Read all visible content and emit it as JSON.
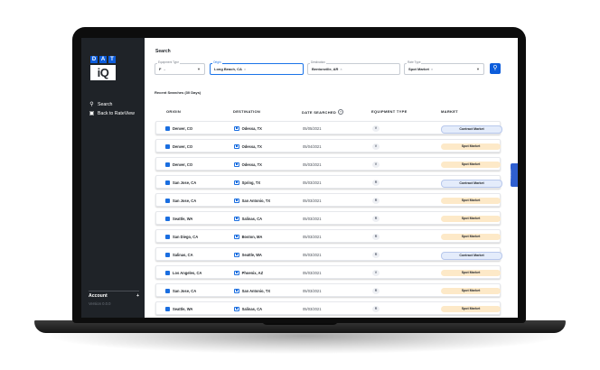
{
  "brand": {
    "dat_letters": [
      "D",
      "A",
      "T"
    ],
    "iq": "iQ"
  },
  "sidebar": {
    "items": [
      {
        "label": "Search",
        "icon": "search-icon"
      },
      {
        "label": "Back to RateView",
        "icon": "external-link-icon"
      }
    ],
    "account_label": "Account",
    "account_add": "+",
    "version": "Version 0.0.0"
  },
  "search": {
    "title": "Search",
    "equipment": {
      "label": "Equipment Type",
      "value": "F"
    },
    "origin": {
      "label": "Origin",
      "value": "Long Beach, CA"
    },
    "destination": {
      "label": "Destination",
      "value": "Bentonville, AR"
    },
    "rate_type": {
      "label": "Rate Type",
      "value": "Spot Market"
    },
    "button_icon": "search-icon"
  },
  "recent": {
    "title": "Recent Searches (30 Days)",
    "columns": {
      "origin": "ORIGIN",
      "destination": "DESTINATION",
      "date": "DATE SEARCHED",
      "date_help": "?",
      "equipment": "EQUIPMENT TYPE",
      "market": "MARKET"
    },
    "rows": [
      {
        "origin": "Denver, CO",
        "destination": "Odessa, TX",
        "date": "05/05/2021",
        "equipment": "V",
        "market": "Contract Market",
        "market_kind": "contract"
      },
      {
        "origin": "Denver, CO",
        "destination": "Odessa, TX",
        "date": "05/04/2021",
        "equipment": "V",
        "market": "Spot Market",
        "market_kind": "spot"
      },
      {
        "origin": "Denver, CO",
        "destination": "Odessa, TX",
        "date": "05/03/2021",
        "equipment": "V",
        "market": "Spot Market",
        "market_kind": "spot"
      },
      {
        "origin": "San Jose, CA",
        "destination": "Spring, TX",
        "date": "05/03/2021",
        "equipment": "R",
        "market": "Contract Market",
        "market_kind": "contract"
      },
      {
        "origin": "San Jose, CA",
        "destination": "San Antonio, TX",
        "date": "05/03/2021",
        "equipment": "R",
        "market": "Spot Market",
        "market_kind": "spot"
      },
      {
        "origin": "Seattle, WA",
        "destination": "Salinas, CA",
        "date": "05/03/2021",
        "equipment": "R",
        "market": "Spot Market",
        "market_kind": "spot"
      },
      {
        "origin": "San Diego, CA",
        "destination": "Boston, MA",
        "date": "05/03/2021",
        "equipment": "R",
        "market": "Spot Market",
        "market_kind": "spot"
      },
      {
        "origin": "Salinas, CA",
        "destination": "Seattle, WA",
        "date": "05/03/2021",
        "equipment": "R",
        "market": "Contract Market",
        "market_kind": "contract"
      },
      {
        "origin": "Los Angeles, CA",
        "destination": "Phoenix, AZ",
        "date": "05/03/2021",
        "equipment": "V",
        "market": "Spot Market",
        "market_kind": "spot"
      },
      {
        "origin": "San Jose, CA",
        "destination": "San Antonio, TX",
        "date": "05/03/2021",
        "equipment": "R",
        "market": "Spot Market",
        "market_kind": "spot"
      },
      {
        "origin": "Seattle, WA",
        "destination": "Salinas, CA",
        "date": "05/03/2021",
        "equipment": "R",
        "market": "Spot Market",
        "market_kind": "spot"
      }
    ]
  },
  "feedback": {
    "label": "Feedback"
  },
  "colors": {
    "brand_blue": "#0d5ddb",
    "sidebar": "#1f2328",
    "spot": "#fde9c8",
    "contract": "#e4ecfb"
  }
}
